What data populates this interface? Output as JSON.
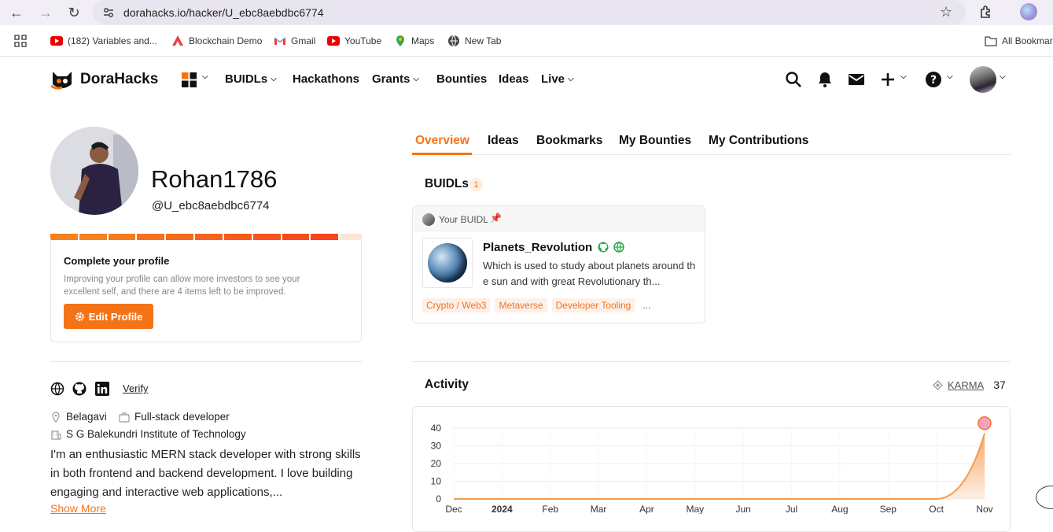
{
  "browser": {
    "url": "dorahacks.io/hacker/U_ebc8aebdbc6774",
    "bookmarks": [
      {
        "label": "(182) Variables and...",
        "icon": "youtube-icon"
      },
      {
        "label": "Blockchain Demo",
        "icon": "avalanche-icon"
      },
      {
        "label": "Gmail",
        "icon": "gmail-icon"
      },
      {
        "label": "YouTube",
        "icon": "youtube-icon"
      },
      {
        "label": "Maps",
        "icon": "maps-icon"
      },
      {
        "label": "New Tab",
        "icon": "globe-icon"
      }
    ],
    "all_bookmarks": "All Bookmar"
  },
  "header": {
    "logo_text": "DoraHacks",
    "nav": [
      {
        "label": "BUIDLs",
        "dropdown": true
      },
      {
        "label": "Hackathons",
        "dropdown": false
      },
      {
        "label": "Grants",
        "dropdown": true
      },
      {
        "label": "Bounties",
        "dropdown": false
      },
      {
        "label": "Ideas",
        "dropdown": false
      },
      {
        "label": "Live",
        "dropdown": true
      }
    ]
  },
  "profile": {
    "username": "Rohan1786",
    "handle": "@U_ebc8aebdbc6774",
    "complete_title": "Complete your profile",
    "complete_desc": "Improving your profile can allow more investors to see your excellent self, and there are 4 items left to be improved.",
    "edit_label": "Edit Profile",
    "verify_label": "Verify",
    "location": "Belagavi",
    "role": "Full-stack developer",
    "institute": "S G Balekundri Institute of Technology",
    "bio": "I'm an enthusiastic MERN stack developer with strong skills in both frontend and backend development. I love building engaging and interactive web applications,...",
    "show_more": "Show More",
    "progress_colors": [
      "#f5821f",
      "#f5821f",
      "#f67a1e",
      "#f6721e",
      "#f76a1e",
      "#f7621e",
      "#f85a1e",
      "#f9521e",
      "#f94a1e",
      "#fa421e"
    ]
  },
  "tabs": [
    "Overview",
    "Ideas",
    "Bookmarks",
    "My Bounties",
    "My Contributions"
  ],
  "buidls": {
    "heading": "BUIDLs",
    "count": "1",
    "card": {
      "label": "Your BUIDL",
      "name": "Planets_Revolution",
      "description": "Which is used to study about planets around the sun and with great Revolutionary th...",
      "tags": [
        "Crypto / Web3",
        "Metaverse",
        "Developer Tooling"
      ],
      "more": "..."
    }
  },
  "activity": {
    "heading": "Activity",
    "karma_label": "KARMA",
    "karma_value": "37"
  },
  "chart_data": {
    "type": "area",
    "categories": [
      "Dec",
      "2024",
      "Feb",
      "Mar",
      "Apr",
      "May",
      "Jun",
      "Jul",
      "Aug",
      "Sep",
      "Oct",
      "Nov"
    ],
    "values": [
      0,
      0,
      0,
      0,
      0,
      0,
      0,
      0,
      0,
      0,
      0,
      37
    ],
    "yticks": [
      0,
      10,
      20,
      30,
      40
    ],
    "ylim": [
      0,
      40
    ],
    "color": "#f59a4a"
  },
  "colors": {
    "accent": "#f57317"
  }
}
